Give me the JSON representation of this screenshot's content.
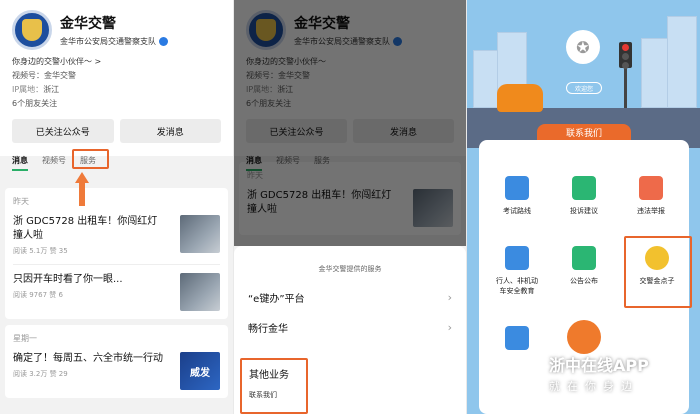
{
  "profile": {
    "name": "金华交警",
    "org": "金华市公安局交通警察支队",
    "bio": "你身边的交警小伙伴～",
    "chevron": ">",
    "channel_label": "视频号：",
    "channel_value": "金华交警",
    "ip_label": "IP属地：",
    "ip_value": "浙江",
    "friends": "6个朋友关注"
  },
  "buttons": {
    "followed": "已关注公众号",
    "message": "发消息"
  },
  "tabs": {
    "messages": "消息",
    "channel": "视频号",
    "service": "服务"
  },
  "feed": {
    "day1": "昨天",
    "day2": "星期一",
    "items": [
      {
        "title": "浙 GDC5728 出租车！你闯红灯撞人啦",
        "meta": "阅读 5.1万  赞 35"
      },
      {
        "title": "只因开车时看了你一眼...",
        "meta": "阅读 9767  赞 6"
      },
      {
        "title": "确定了！每周五、六全市统一行动",
        "meta": "阅读 3.2万  赞 29",
        "thumb_text": "威发"
      }
    ]
  },
  "sheet": {
    "title": "金华交警提供的服务",
    "rows": [
      "“e键办”平台",
      "畅行金华"
    ],
    "other": "其他业务",
    "contact": "联系我们",
    "chevron": "›"
  },
  "app": {
    "welcome": "欢迎您",
    "contact_tab": "联系我们",
    "medal_glyph": "✪",
    "services": [
      {
        "label": "考试路线",
        "color": "#3b8be0"
      },
      {
        "label": "投诉建议",
        "color": "#2bb673"
      },
      {
        "label": "违法举报",
        "color": "#ee6a4a"
      },
      {
        "label": "行人、非机动车安全教育",
        "color": "#3b8be0"
      },
      {
        "label": "公告公布",
        "color": "#2bb673"
      },
      {
        "label": "交警金点子",
        "color": "#f2c12e"
      }
    ]
  },
  "watermark": {
    "logo": "ZJOL",
    "name": "浙中在线APP",
    "slogan": "就在你身边"
  }
}
